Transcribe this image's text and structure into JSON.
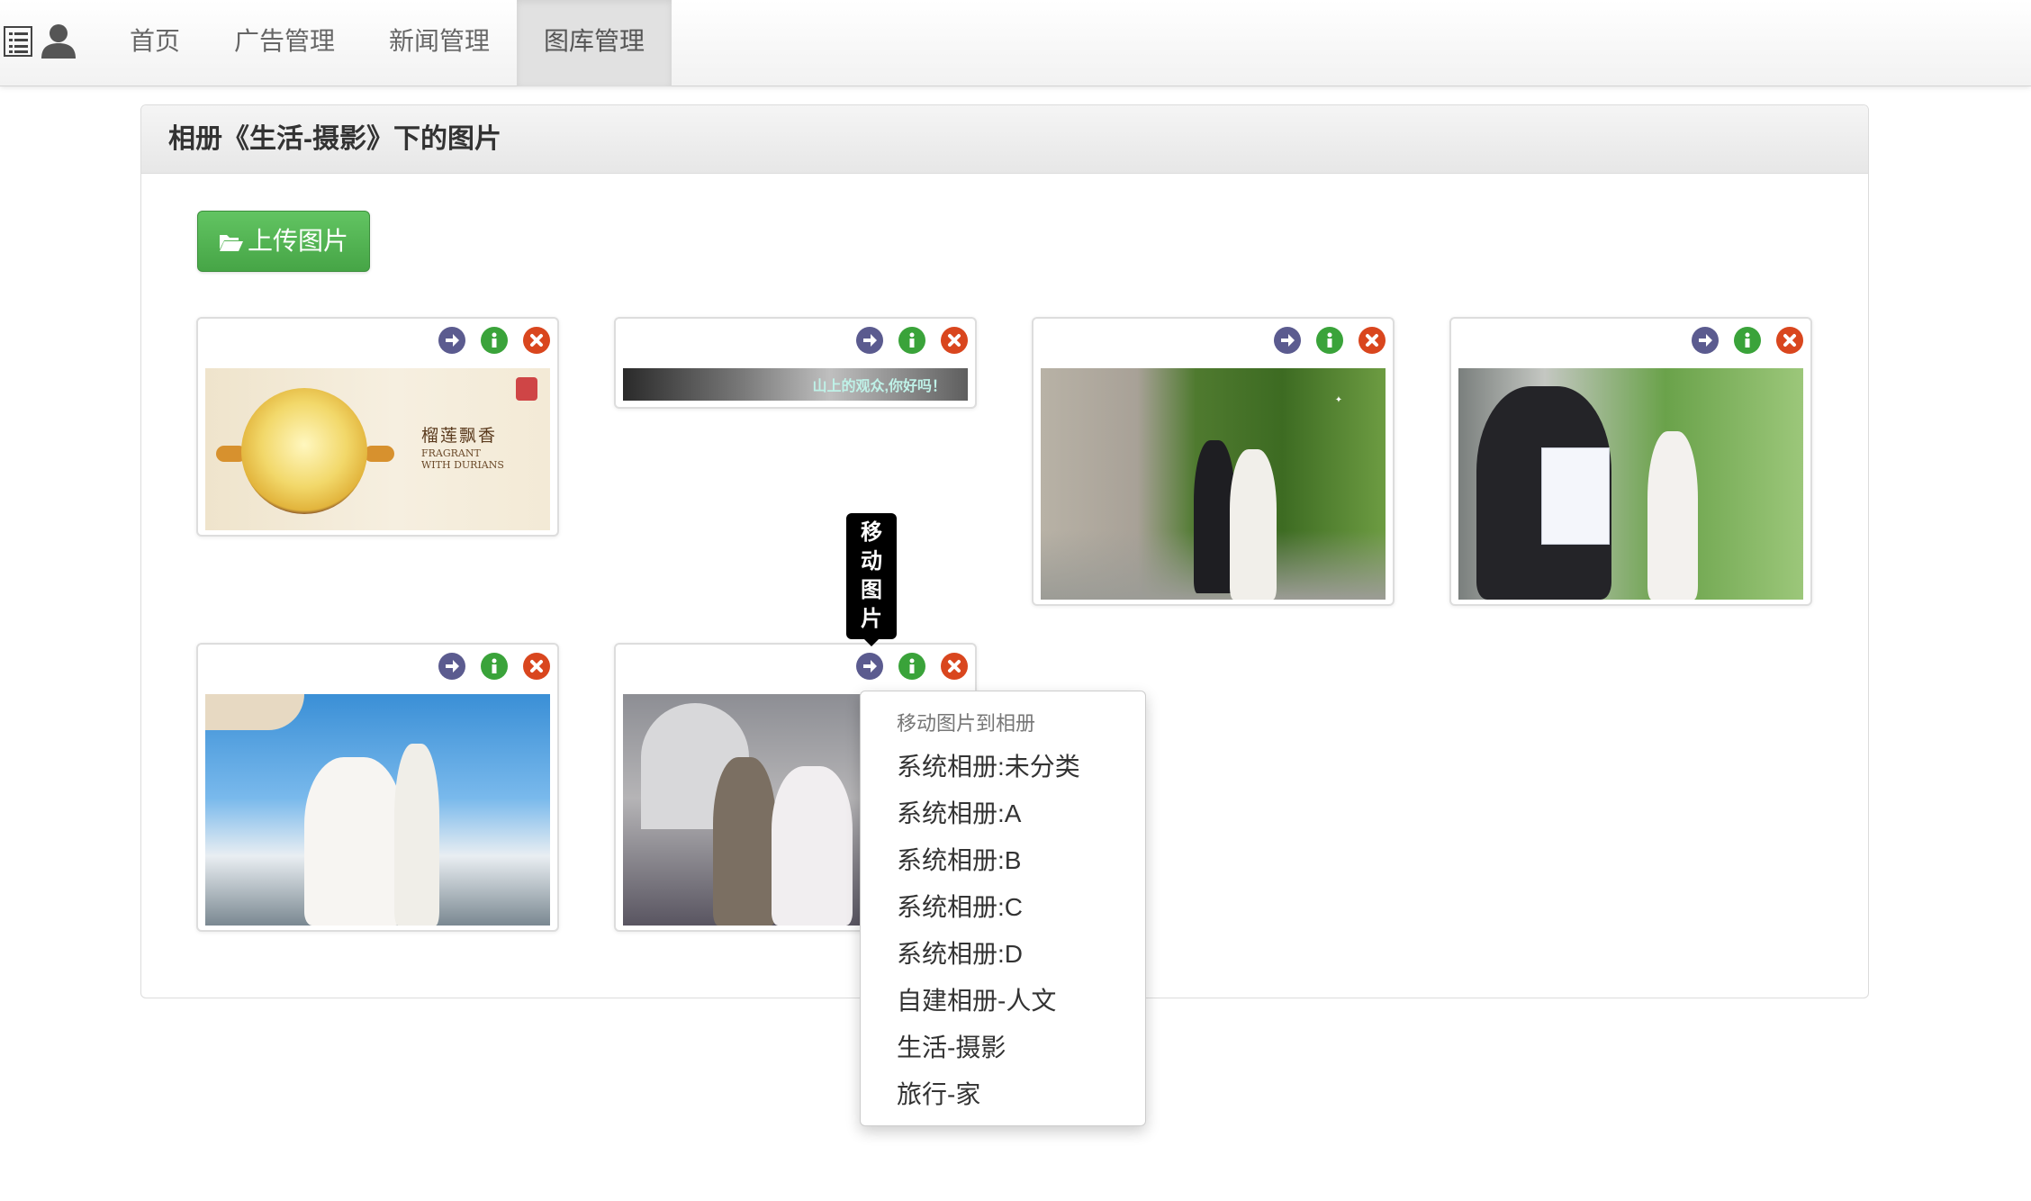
{
  "nav": {
    "items": [
      "首页",
      "广告管理",
      "新闻管理",
      "图库管理"
    ],
    "active": "图库管理"
  },
  "panel": {
    "title": "相册《生活-摄影》下的图片",
    "upload_label": "上传图片"
  },
  "photos": {
    "durian": {
      "title_cn": "榴莲飘香",
      "title_en_1": "FRAGRANT",
      "title_en_2": "WITH DURIANS"
    },
    "banner": {
      "text": "山上的观众,你好吗！"
    }
  },
  "tooltip": {
    "chars": [
      "移",
      "动",
      "图",
      "片"
    ]
  },
  "dropdown": {
    "header": "移动图片到相册",
    "items": [
      "系统相册:未分类",
      "系统相册:A",
      "系统相册:B",
      "系统相册:C",
      "系统相册:D",
      "自建相册-人文",
      "生活-摄影",
      "旅行-家"
    ]
  },
  "colors": {
    "move": "#5b5b8f",
    "info": "#3aa33a",
    "delete": "#d9461e",
    "upload": "#46a546"
  },
  "icons": [
    "list-icon",
    "user-icon",
    "folder-open-icon",
    "arrow-right-icon",
    "info-icon",
    "close-icon"
  ]
}
